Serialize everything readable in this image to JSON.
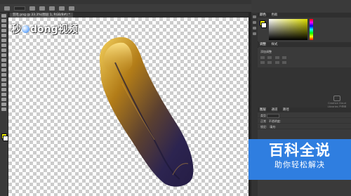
{
  "app": {
    "doc_tab": "羽毛.png @ 33.3%(图层 1, RGB/8#) *"
  },
  "watermark": {
    "text_left": "秒",
    "text_mid": "dong",
    "text_right": "视频"
  },
  "panels": {
    "color_tabs": [
      "颜色",
      "色板"
    ],
    "adjust_tabs": [
      "调整",
      "样式"
    ],
    "adjust_title": "添加调整",
    "hint_text": "Creative Cloud Libraries 已停用",
    "layers_tabs": [
      "图层",
      "通道",
      "路径"
    ],
    "layers_kind": "类型",
    "layers_mode": "正常",
    "layers_opacity": "不透明度:",
    "layers_lock": "锁定:",
    "layers_fill": "填充:"
  },
  "logo": {
    "title": "百科全说",
    "subtitle": "助你轻松解决"
  },
  "colors": {
    "foreground": "#f0f000",
    "background": "#ffffff",
    "logo_blue": "#2f7ee0"
  }
}
